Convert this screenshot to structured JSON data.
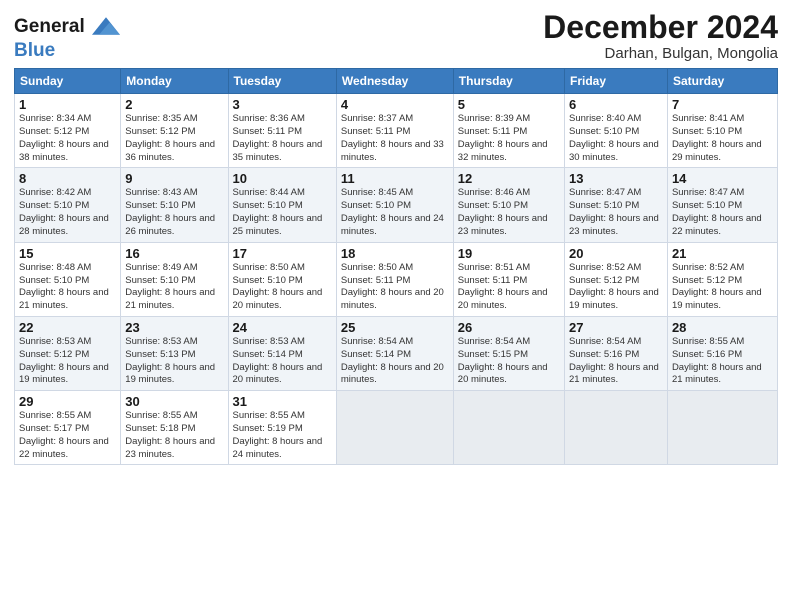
{
  "logo": {
    "line1": "General",
    "line2": "Blue"
  },
  "title": "December 2024",
  "subtitle": "Darhan, Bulgan, Mongolia",
  "days_header": [
    "Sunday",
    "Monday",
    "Tuesday",
    "Wednesday",
    "Thursday",
    "Friday",
    "Saturday"
  ],
  "weeks": [
    [
      {
        "day": "1",
        "sunrise": "8:34 AM",
        "sunset": "5:12 PM",
        "daylight": "8 hours and 38 minutes."
      },
      {
        "day": "2",
        "sunrise": "8:35 AM",
        "sunset": "5:12 PM",
        "daylight": "8 hours and 36 minutes."
      },
      {
        "day": "3",
        "sunrise": "8:36 AM",
        "sunset": "5:11 PM",
        "daylight": "8 hours and 35 minutes."
      },
      {
        "day": "4",
        "sunrise": "8:37 AM",
        "sunset": "5:11 PM",
        "daylight": "8 hours and 33 minutes."
      },
      {
        "day": "5",
        "sunrise": "8:39 AM",
        "sunset": "5:11 PM",
        "daylight": "8 hours and 32 minutes."
      },
      {
        "day": "6",
        "sunrise": "8:40 AM",
        "sunset": "5:10 PM",
        "daylight": "8 hours and 30 minutes."
      },
      {
        "day": "7",
        "sunrise": "8:41 AM",
        "sunset": "5:10 PM",
        "daylight": "8 hours and 29 minutes."
      }
    ],
    [
      {
        "day": "8",
        "sunrise": "8:42 AM",
        "sunset": "5:10 PM",
        "daylight": "8 hours and 28 minutes."
      },
      {
        "day": "9",
        "sunrise": "8:43 AM",
        "sunset": "5:10 PM",
        "daylight": "8 hours and 26 minutes."
      },
      {
        "day": "10",
        "sunrise": "8:44 AM",
        "sunset": "5:10 PM",
        "daylight": "8 hours and 25 minutes."
      },
      {
        "day": "11",
        "sunrise": "8:45 AM",
        "sunset": "5:10 PM",
        "daylight": "8 hours and 24 minutes."
      },
      {
        "day": "12",
        "sunrise": "8:46 AM",
        "sunset": "5:10 PM",
        "daylight": "8 hours and 23 minutes."
      },
      {
        "day": "13",
        "sunrise": "8:47 AM",
        "sunset": "5:10 PM",
        "daylight": "8 hours and 23 minutes."
      },
      {
        "day": "14",
        "sunrise": "8:47 AM",
        "sunset": "5:10 PM",
        "daylight": "8 hours and 22 minutes."
      }
    ],
    [
      {
        "day": "15",
        "sunrise": "8:48 AM",
        "sunset": "5:10 PM",
        "daylight": "8 hours and 21 minutes."
      },
      {
        "day": "16",
        "sunrise": "8:49 AM",
        "sunset": "5:10 PM",
        "daylight": "8 hours and 21 minutes."
      },
      {
        "day": "17",
        "sunrise": "8:50 AM",
        "sunset": "5:10 PM",
        "daylight": "8 hours and 20 minutes."
      },
      {
        "day": "18",
        "sunrise": "8:50 AM",
        "sunset": "5:11 PM",
        "daylight": "8 hours and 20 minutes."
      },
      {
        "day": "19",
        "sunrise": "8:51 AM",
        "sunset": "5:11 PM",
        "daylight": "8 hours and 20 minutes."
      },
      {
        "day": "20",
        "sunrise": "8:52 AM",
        "sunset": "5:12 PM",
        "daylight": "8 hours and 19 minutes."
      },
      {
        "day": "21",
        "sunrise": "8:52 AM",
        "sunset": "5:12 PM",
        "daylight": "8 hours and 19 minutes."
      }
    ],
    [
      {
        "day": "22",
        "sunrise": "8:53 AM",
        "sunset": "5:12 PM",
        "daylight": "8 hours and 19 minutes."
      },
      {
        "day": "23",
        "sunrise": "8:53 AM",
        "sunset": "5:13 PM",
        "daylight": "8 hours and 19 minutes."
      },
      {
        "day": "24",
        "sunrise": "8:53 AM",
        "sunset": "5:14 PM",
        "daylight": "8 hours and 20 minutes."
      },
      {
        "day": "25",
        "sunrise": "8:54 AM",
        "sunset": "5:14 PM",
        "daylight": "8 hours and 20 minutes."
      },
      {
        "day": "26",
        "sunrise": "8:54 AM",
        "sunset": "5:15 PM",
        "daylight": "8 hours and 20 minutes."
      },
      {
        "day": "27",
        "sunrise": "8:54 AM",
        "sunset": "5:16 PM",
        "daylight": "8 hours and 21 minutes."
      },
      {
        "day": "28",
        "sunrise": "8:55 AM",
        "sunset": "5:16 PM",
        "daylight": "8 hours and 21 minutes."
      }
    ],
    [
      {
        "day": "29",
        "sunrise": "8:55 AM",
        "sunset": "5:17 PM",
        "daylight": "8 hours and 22 minutes."
      },
      {
        "day": "30",
        "sunrise": "8:55 AM",
        "sunset": "5:18 PM",
        "daylight": "8 hours and 23 minutes."
      },
      {
        "day": "31",
        "sunrise": "8:55 AM",
        "sunset": "5:19 PM",
        "daylight": "8 hours and 24 minutes."
      },
      null,
      null,
      null,
      null
    ]
  ]
}
